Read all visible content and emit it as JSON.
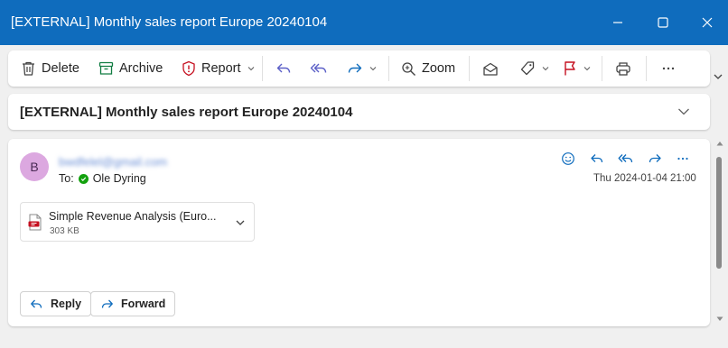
{
  "window": {
    "title": "[EXTERNAL] Monthly sales report Europe 20240104",
    "accent_color": "#0f6cbd"
  },
  "toolbar": {
    "delete_label": "Delete",
    "archive_label": "Archive",
    "report_label": "Report",
    "zoom_label": "Zoom",
    "icons": [
      "trash-icon",
      "archive-icon",
      "shield-icon",
      "reply-icon",
      "reply-all-icon",
      "forward-icon",
      "zoom-icon",
      "envelope-open-icon",
      "tag-icon",
      "flag-icon",
      "print-icon",
      "more-icon"
    ]
  },
  "subject": {
    "text": "[EXTERNAL] Monthly sales report Europe 20240104"
  },
  "message": {
    "avatar_initial": "B",
    "sender": "bwdfelel@gmail.com",
    "to_prefix": "To:",
    "recipient": "Ole Dyring",
    "date": "Thu 2024-01-04 21:00",
    "attachment": {
      "name": "Simple Revenue Analysis (Euro...",
      "size": "303 KB"
    },
    "reply_label": "Reply",
    "forward_label": "Forward"
  }
}
